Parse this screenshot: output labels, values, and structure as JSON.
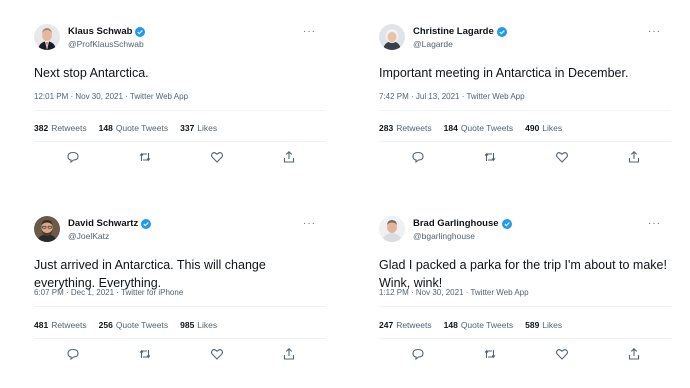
{
  "colors": {
    "verified": "#1d9bf0",
    "secondary_text": "#536471",
    "primary_text": "#0f1419",
    "divider": "#eff3f4"
  },
  "icons": {
    "reply": "reply-icon",
    "retweet": "retweet-icon",
    "like": "heart-icon",
    "share": "share-icon",
    "more": "more-icon",
    "verified": "verified-badge-icon"
  },
  "tweets": [
    {
      "name": "Klaus Schwab",
      "handle": "@ProfKlausSchwab",
      "text": "Next stop Antarctica.",
      "time": "12:01 PM",
      "date": "Nov 30, 2021",
      "source": "Twitter Web App",
      "retweets": "382",
      "retweets_label": "Retweets",
      "quotes": "148",
      "quotes_label": "Quote Tweets",
      "likes": "337",
      "likes_label": "Likes"
    },
    {
      "name": "Christine Lagarde",
      "handle": "@Lagarde",
      "text": "Important meeting in Antarctica in December.",
      "time": "7:42 PM",
      "date": "Jul 13, 2021",
      "source": "Twitter Web App",
      "retweets": "283",
      "retweets_label": "Retweets",
      "quotes": "184",
      "quotes_label": "Quote Tweets",
      "likes": "490",
      "likes_label": "Likes"
    },
    {
      "name": "David Schwartz",
      "handle": "@JoelKatz",
      "text": "Just arrived in Antarctica. This will change everything. Everything.",
      "time": "6:07 PM",
      "date": "Dec 1, 2021",
      "source": "Twitter for iPhone",
      "retweets": "481",
      "retweets_label": "Retweets",
      "quotes": "256",
      "quotes_label": "Quote Tweets",
      "likes": "985",
      "likes_label": "Likes"
    },
    {
      "name": "Brad Garlinghouse",
      "handle": "@bgarlinghouse",
      "text": "Glad I packed a parka for the trip I'm about to make! Wink, wink!",
      "time": "1:12 PM",
      "date": "Nov 30, 2021",
      "source": "Twitter Web App",
      "retweets": "247",
      "retweets_label": "Retweets",
      "quotes": "148",
      "quotes_label": "Quote Tweets",
      "likes": "589",
      "likes_label": "Likes"
    }
  ]
}
